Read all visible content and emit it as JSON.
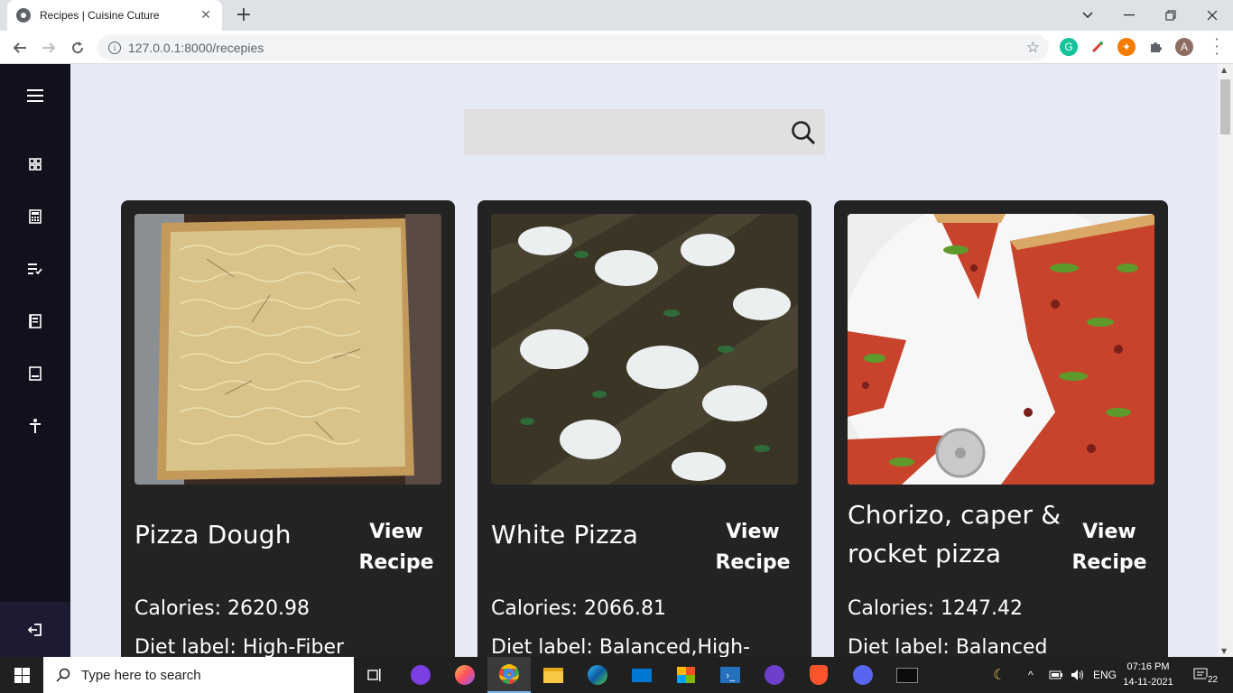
{
  "browser": {
    "tab_title": "Recipes | Cuisine Cuture",
    "url": "127.0.0.1:8000/recepies",
    "new_tab": "+",
    "tab_close": "✕"
  },
  "profile_initial": "A",
  "search": {
    "value": "",
    "placeholder": ""
  },
  "recipes": [
    {
      "name": "Pizza Dough",
      "view": "View Recipe",
      "calories": "Calories: 2620.98",
      "diet": "Diet label: High-Fiber"
    },
    {
      "name": "White Pizza",
      "view": "View Recipe",
      "calories": "Calories: 2066.81",
      "diet": "Diet label: Balanced,High-"
    },
    {
      "name": "Chorizo, caper & rocket pizza",
      "view": "View Recipe",
      "calories": "Calories: 1247.42",
      "diet": "Diet label: Balanced"
    }
  ],
  "taskbar": {
    "search_placeholder": "Type here to search",
    "language": "ENG",
    "time": "07:16 PM",
    "date": "14-11-2021",
    "notifications": "22"
  },
  "colors": {
    "sidebar": "#11101d",
    "card": "#232323",
    "page_bg": "#e6eaf6"
  }
}
